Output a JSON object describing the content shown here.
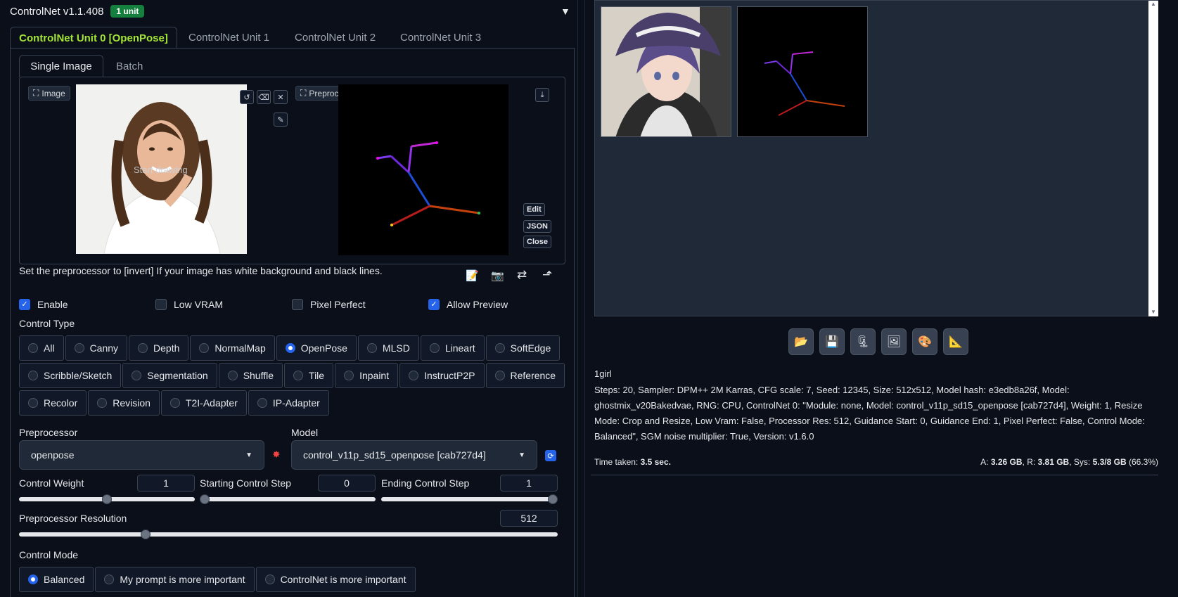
{
  "header": {
    "title": "ControlNet v1.1.408",
    "badge": "1 unit",
    "collapse_icon": "triangle-down-icon"
  },
  "unit_tabs": [
    {
      "label": "ControlNet Unit 0 [OpenPose]",
      "active": true
    },
    {
      "label": "ControlNet Unit 1",
      "active": false
    },
    {
      "label": "ControlNet Unit 2",
      "active": false
    },
    {
      "label": "ControlNet Unit 3",
      "active": false
    }
  ],
  "sub_tabs": [
    {
      "label": "Single Image",
      "active": true
    },
    {
      "label": "Batch",
      "active": false
    }
  ],
  "image_panel": {
    "label": "Image",
    "overlay_text": "Start drawing"
  },
  "preview_panel": {
    "label": "Preprocessor Preview",
    "buttons": [
      "Edit",
      "JSON",
      "Close"
    ]
  },
  "hint_text": "Set the preprocessor to [invert] If your image has white background and black lines.",
  "checkboxes": [
    {
      "label": "Enable",
      "checked": true
    },
    {
      "label": "Low VRAM",
      "checked": false
    },
    {
      "label": "Pixel Perfect",
      "checked": false
    },
    {
      "label": "Allow Preview",
      "checked": true
    }
  ],
  "control_type": {
    "label": "Control Type",
    "rows": [
      [
        "All",
        "Canny",
        "Depth",
        "NormalMap",
        "OpenPose",
        "MLSD",
        "Lineart",
        "SoftEdge"
      ],
      [
        "Scribble/Sketch",
        "Segmentation",
        "Shuffle",
        "Tile",
        "Inpaint",
        "InstructP2P",
        "Reference"
      ],
      [
        "Recolor",
        "Revision",
        "T2I-Adapter",
        "IP-Adapter"
      ]
    ],
    "selected": "OpenPose"
  },
  "preprocessor": {
    "label": "Preprocessor",
    "value": "openpose"
  },
  "model": {
    "label": "Model",
    "value": "control_v11p_sd15_openpose [cab727d4]"
  },
  "sliders": {
    "weight": {
      "label": "Control Weight",
      "value": "1",
      "fraction": 0.5
    },
    "start": {
      "label": "Starting Control Step",
      "value": "0",
      "fraction": 0.0
    },
    "end": {
      "label": "Ending Control Step",
      "value": "1",
      "fraction": 1.0
    },
    "resolution": {
      "label": "Preprocessor Resolution",
      "value": "512",
      "fraction": 0.23
    }
  },
  "control_mode": {
    "label": "Control Mode",
    "options": [
      "Balanced",
      "My prompt is more important",
      "ControlNet is more important"
    ],
    "selected": "Balanced"
  },
  "output": {
    "prompt": "1girl",
    "params": "Steps: 20, Sampler: DPM++ 2M Karras, CFG scale: 7, Seed: 12345, Size: 512x512, Model hash: e3edb8a26f, Model: ghostmix_v20Bakedvae, RNG: CPU, ControlNet 0: \"Module: none, Model: control_v11p_sd15_openpose [cab727d4], Weight: 1, Resize Mode: Crop and Resize, Low Vram: False, Processor Res: 512, Guidance Start: 0, Guidance End: 1, Pixel Perfect: False, Control Mode: Balanced\", SGM noise multiplier: True, Version: v1.6.0",
    "time_label": "Time taken:",
    "time_value": "3.5 sec.",
    "mem_a_label": "A:",
    "mem_a": "3.26 GB",
    "mem_r_label": "R:",
    "mem_r": "3.81 GB",
    "mem_sys_label": "Sys:",
    "mem_sys": "5.3/8 GB",
    "mem_pct": "(66.3%)"
  },
  "toolbar_icons": [
    "folder-icon",
    "save-icon",
    "zip-icon",
    "send-to-img2img-icon",
    "send-to-inpaint-icon",
    "send-to-extras-icon"
  ]
}
